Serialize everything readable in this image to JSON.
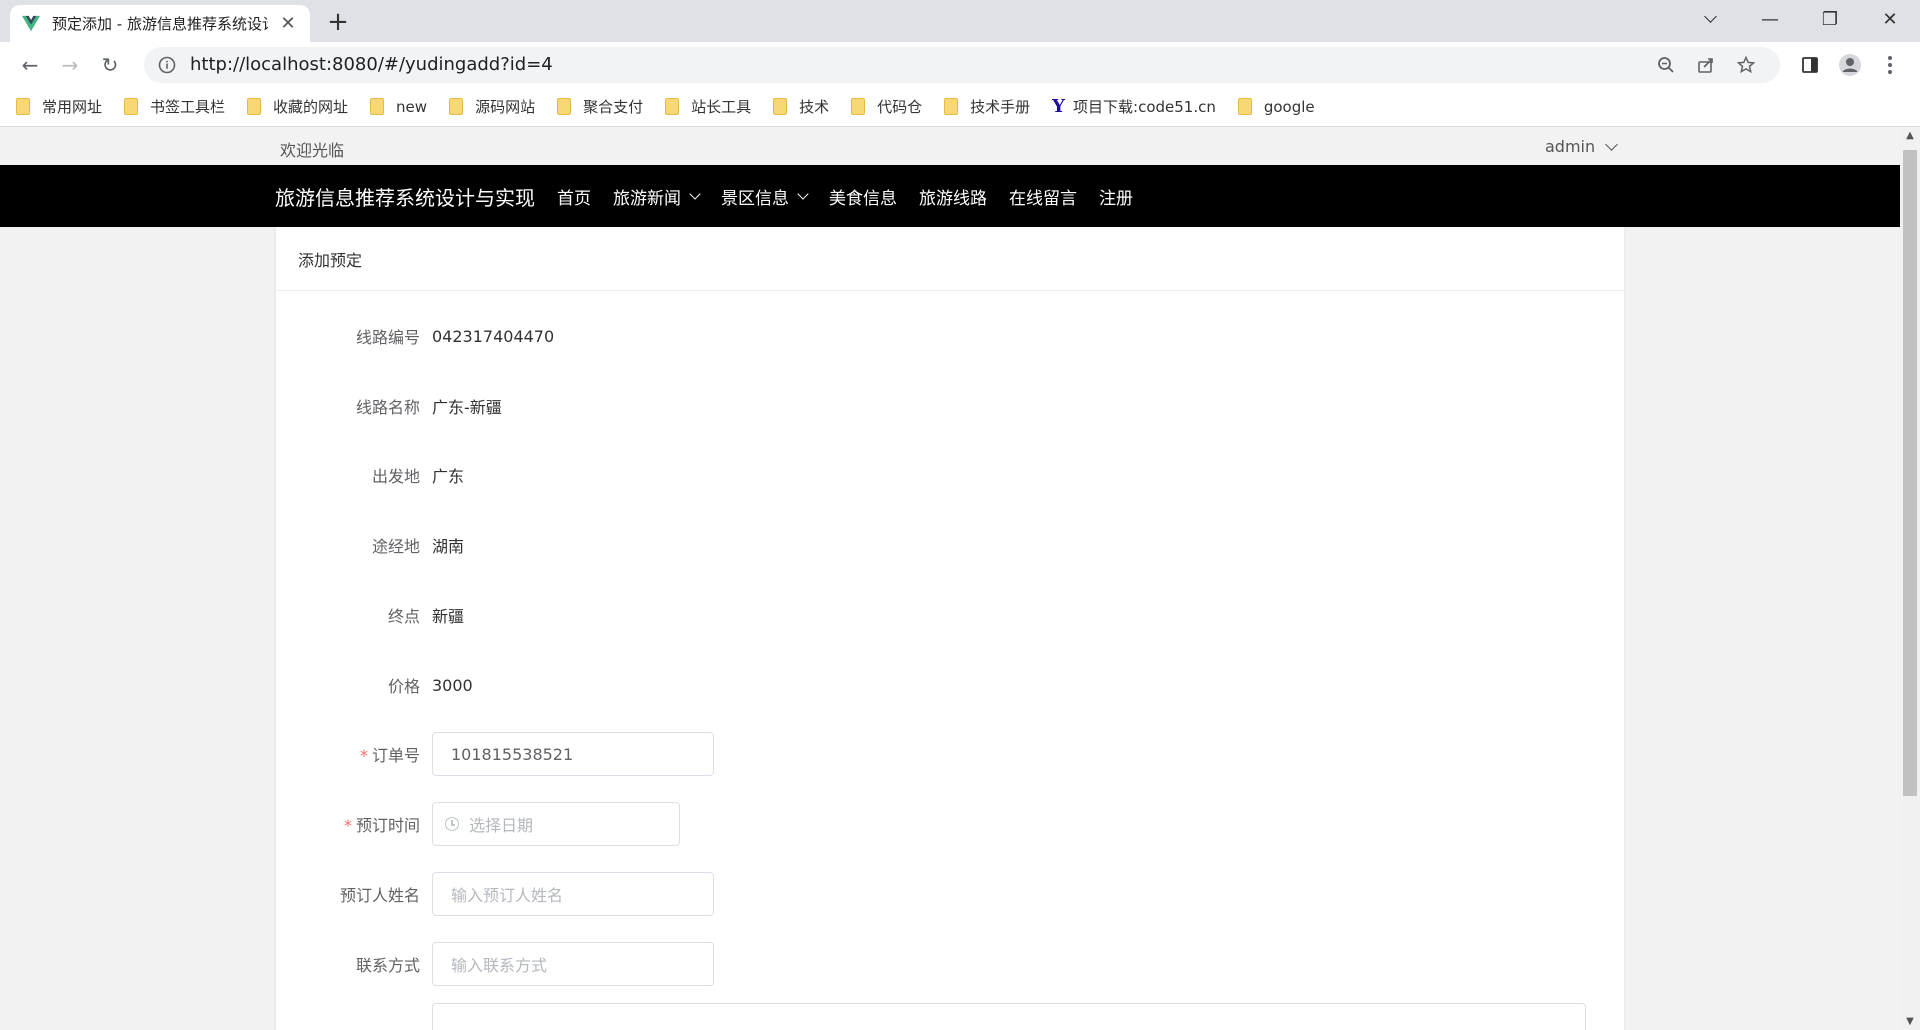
{
  "browser": {
    "tab_title": "预定添加 - 旅游信息推荐系统设计",
    "url": "http://localhost:8080/#/yudingadd?id=4",
    "bookmarks": [
      {
        "label": "常用网址",
        "icon": "folder-icon"
      },
      {
        "label": "书签工具栏",
        "icon": "folder-icon"
      },
      {
        "label": "收藏的网址",
        "icon": "folder-icon"
      },
      {
        "label": "new",
        "icon": "folder-icon"
      },
      {
        "label": "源码网站",
        "icon": "folder-icon"
      },
      {
        "label": "聚合支付",
        "icon": "folder-icon"
      },
      {
        "label": "站长工具",
        "icon": "folder-icon"
      },
      {
        "label": "技术",
        "icon": "folder-icon"
      },
      {
        "label": "代码仓",
        "icon": "folder-icon"
      },
      {
        "label": "技术手册",
        "icon": "folder-icon"
      },
      {
        "label": "项目下载:code51.cn",
        "icon": "site-y-icon"
      },
      {
        "label": "google",
        "icon": "folder-icon"
      }
    ]
  },
  "topbar": {
    "welcome": "欢迎光临",
    "user": "admin"
  },
  "navbar": {
    "site_title": "旅游信息推荐系统设计与实现",
    "items": [
      {
        "label": "首页",
        "dropdown": false
      },
      {
        "label": "旅游新闻",
        "dropdown": true
      },
      {
        "label": "景区信息",
        "dropdown": true
      },
      {
        "label": "美食信息",
        "dropdown": false
      },
      {
        "label": "旅游线路",
        "dropdown": false
      },
      {
        "label": "在线留言",
        "dropdown": false
      },
      {
        "label": "注册",
        "dropdown": false
      }
    ]
  },
  "card": {
    "title": "添加预定"
  },
  "form": {
    "route_no": {
      "label": "线路编号",
      "value": "042317404470"
    },
    "route_name": {
      "label": "线路名称",
      "value": "广东-新疆"
    },
    "departure": {
      "label": "出发地",
      "value": "广东"
    },
    "via": {
      "label": "途经地",
      "value": "湖南"
    },
    "destination": {
      "label": "终点",
      "value": "新疆"
    },
    "price": {
      "label": "价格",
      "value": "3000"
    },
    "order_no": {
      "label": "订单号",
      "required": "*",
      "value": "101815538521"
    },
    "booking_time": {
      "label": "预订时间",
      "required": "*",
      "placeholder": "选择日期"
    },
    "booker_name": {
      "label": "预订人姓名",
      "placeholder": "输入预订人姓名"
    },
    "contact": {
      "label": "联系方式",
      "placeholder": "输入联系方式"
    }
  }
}
